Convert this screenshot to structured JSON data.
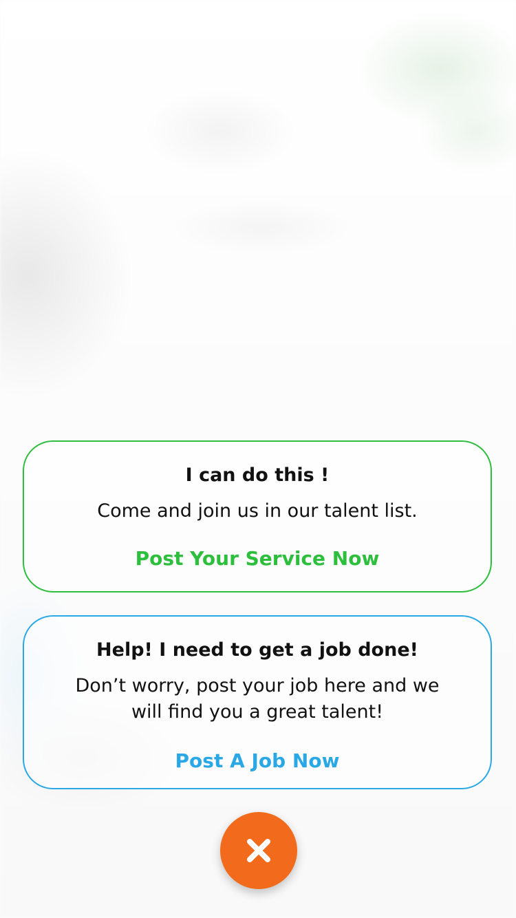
{
  "talent_card": {
    "title": "I can do this !",
    "description": "Come and join us in our talent list.",
    "action_label": "Post Your Service Now"
  },
  "job_card": {
    "title": "Help! I need to get a job done!",
    "description": "Don’t worry, post your job here and we will find you a great talent!",
    "action_label": "Post A Job Now"
  },
  "close_button": {
    "icon": "close-icon"
  },
  "colors": {
    "talent_accent": "#2dbe3e",
    "job_accent": "#2aa8e6",
    "close_button_bg": "#f26a1b"
  }
}
